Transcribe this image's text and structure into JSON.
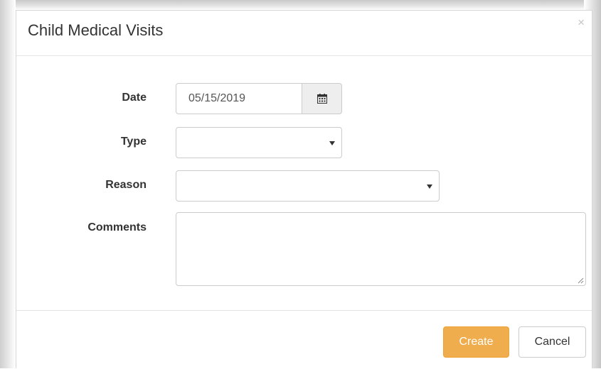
{
  "dialog": {
    "title": "Child Medical Visits",
    "close_label": "×"
  },
  "form": {
    "date": {
      "label": "Date",
      "value": "05/15/2019",
      "icon": "calendar-icon"
    },
    "type": {
      "label": "Type",
      "value": ""
    },
    "reason": {
      "label": "Reason",
      "value": ""
    },
    "comments": {
      "label": "Comments",
      "value": ""
    }
  },
  "footer": {
    "create_label": "Create",
    "cancel_label": "Cancel"
  },
  "colors": {
    "primary_button": "#f0ad4e",
    "border": "#cccccc",
    "text": "#333333"
  }
}
